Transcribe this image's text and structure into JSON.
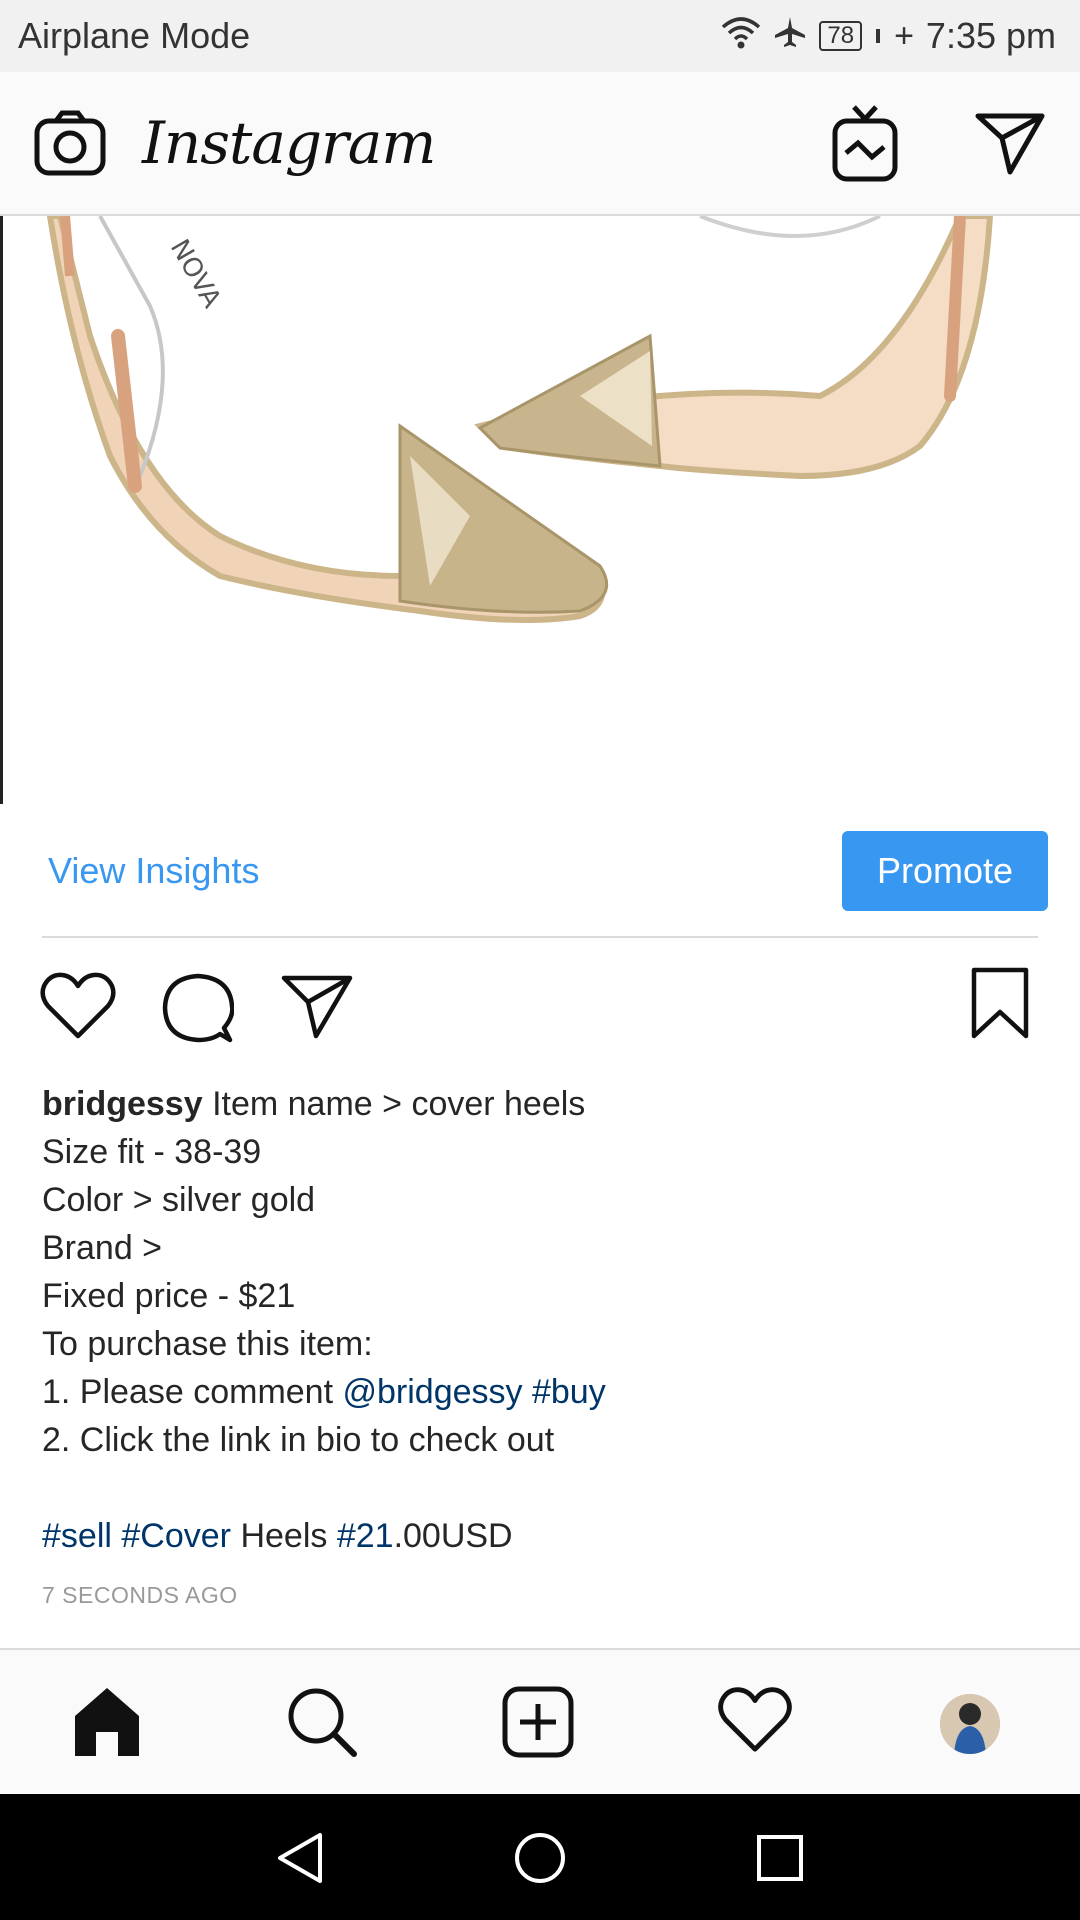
{
  "status_bar": {
    "left_text": "Airplane Mode",
    "battery_level": "78",
    "charging_symbol": "+",
    "time": "7:35 pm",
    "icons": [
      "wifi-icon",
      "airplane-icon",
      "battery-icon"
    ]
  },
  "app_bar": {
    "logo_text": "Instagram",
    "icons": [
      "camera-icon",
      "igtv-icon",
      "direct-message-icon"
    ]
  },
  "post": {
    "image_description_icon": "post-photo",
    "view_insights_label": "View Insights",
    "promote_label": "Promote",
    "action_icons": [
      "like-icon",
      "comment-icon",
      "share-icon",
      "bookmark-icon"
    ],
    "caption": {
      "username": "bridgessy",
      "line1_text": " Item name > cover heels",
      "line2": "Size fit - 38-39",
      "line3": "Color > silver gold",
      "line4": "Brand >",
      "line5": "Fixed price - $21",
      "line6": "To purchase this item:",
      "line7_prefix": "1. Please comment ",
      "line7_mention": "@bridgessy",
      "line7_space": " ",
      "line7_tag": "#buy",
      "line8": "2. Click the link in bio to check out",
      "line10_tag1": "#sell",
      "line10_space1": " ",
      "line10_tag2": "#Cover",
      "line10_text": " Heels ",
      "line10_tag3": "#21",
      "line10_suffix": ".00USD"
    },
    "timestamp": "7 SECONDS AGO"
  },
  "bottom_nav": {
    "items": [
      "home-icon",
      "search-icon",
      "new-post-icon",
      "activity-icon",
      "profile-avatar"
    ]
  },
  "system_nav": {
    "items": [
      "back-icon",
      "home-circle-icon",
      "recents-icon"
    ]
  },
  "colors": {
    "accent_blue": "#3897f0",
    "hashtag_blue": "#003569",
    "timestamp_gray": "#999999"
  }
}
